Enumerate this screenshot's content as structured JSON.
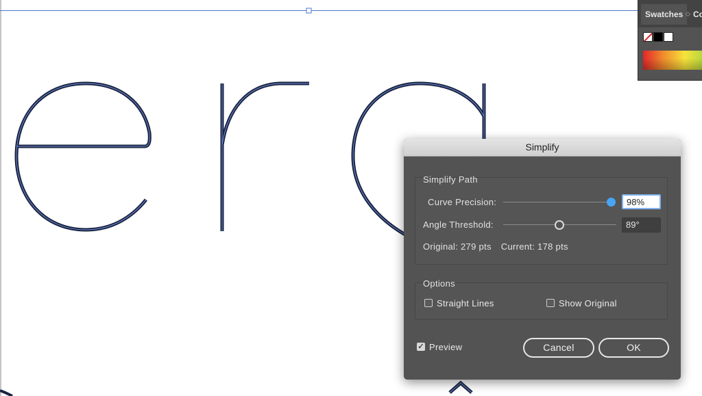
{
  "swatches_panel": {
    "tab_label": "Swatches",
    "tab_sep_glyph": "◇",
    "next_tab_label": "Co"
  },
  "dialog": {
    "title": "Simplify",
    "simplify_path_label": "Simplify Path",
    "curve_precision": {
      "label": "Curve Precision:",
      "value": "98%",
      "slider_fraction": 0.98
    },
    "angle_threshold": {
      "label": "Angle Threshold:",
      "value": "89°",
      "slider_fraction": 0.49
    },
    "original_label": "Original: 279 pts",
    "current_label": "Current: 178 pts",
    "options_label": "Options",
    "straight_lines": {
      "label": "Straight Lines",
      "checked": false
    },
    "show_original": {
      "label": "Show Original",
      "checked": false
    },
    "preview": {
      "label": "Preview",
      "checked": true
    },
    "cancel_label": "Cancel",
    "ok_label": "OK"
  },
  "colors": {
    "path_outline": "#1a2340",
    "path_highlight": "#6f8dd6",
    "selection": "#4a78c8",
    "dialog_bg": "#535353",
    "accent_blue": "#46a5f5"
  }
}
